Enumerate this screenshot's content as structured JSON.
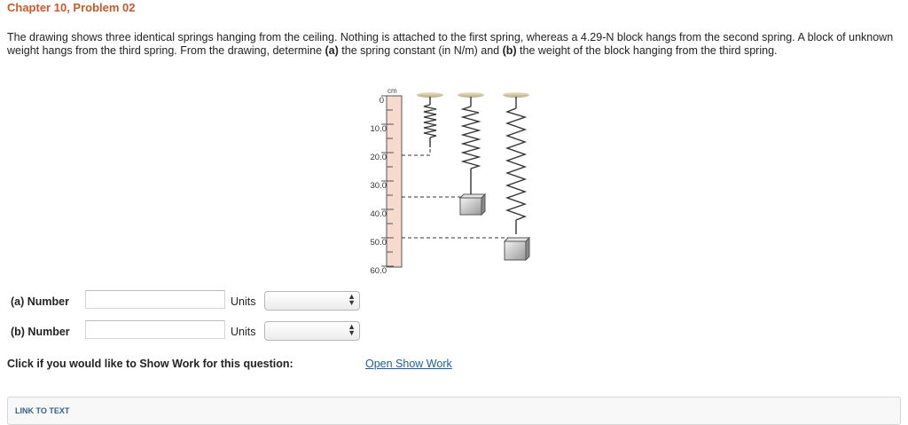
{
  "title": "Chapter 10, Problem 02",
  "problem": {
    "part1": "The drawing shows three identical springs hanging from the ceiling. Nothing is attached to the first spring, whereas a 4.29-N block hangs from the second spring. A block of unknown weight hangs from the third spring. From the drawing, determine ",
    "a_marker": "(a)",
    "part2": " the spring constant (in N/m) and ",
    "b_marker": "(b)",
    "part3": " the weight of the block hanging from the third spring."
  },
  "figure": {
    "ruler_unit": "cm",
    "ticks": [
      "0",
      "10.0",
      "20.0",
      "30.0",
      "40.0",
      "50.0",
      "60.0"
    ]
  },
  "answers": {
    "a": {
      "label": "(a) Number",
      "value": "",
      "units_label": "Units",
      "selected": ""
    },
    "b": {
      "label": "(b) Number",
      "value": "",
      "units_label": "Units",
      "selected": ""
    }
  },
  "show_work": {
    "prompt": "Click if you would like to Show Work for this question:",
    "link": "Open Show Work"
  },
  "link_to_text": "LINK TO TEXT"
}
